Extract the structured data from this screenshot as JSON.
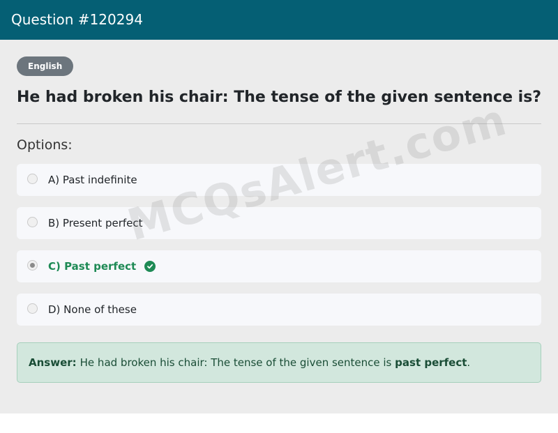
{
  "header": {
    "title": "Question #120294"
  },
  "category_badge": "English",
  "question": "He had broken his chair: The tense of the given sentence is?",
  "options_heading": "Options:",
  "options": [
    {
      "label": "A) Past indefinite",
      "selected": false,
      "correct": false
    },
    {
      "label": "B) Present perfect",
      "selected": false,
      "correct": false
    },
    {
      "label": "C) Past perfect",
      "selected": true,
      "correct": true
    },
    {
      "label": "D) None of these",
      "selected": false,
      "correct": false
    }
  ],
  "answer": {
    "label": "Answer:",
    "text": "He had broken his chair: The tense of the given sentence is",
    "highlight": "past perfect",
    "suffix": "."
  },
  "watermark": "MCQsAlert.com",
  "colors": {
    "header_bg": "#055f74",
    "correct": "#1e8a55",
    "answer_bg": "#d2e7dd",
    "badge_bg": "#6c757d"
  }
}
